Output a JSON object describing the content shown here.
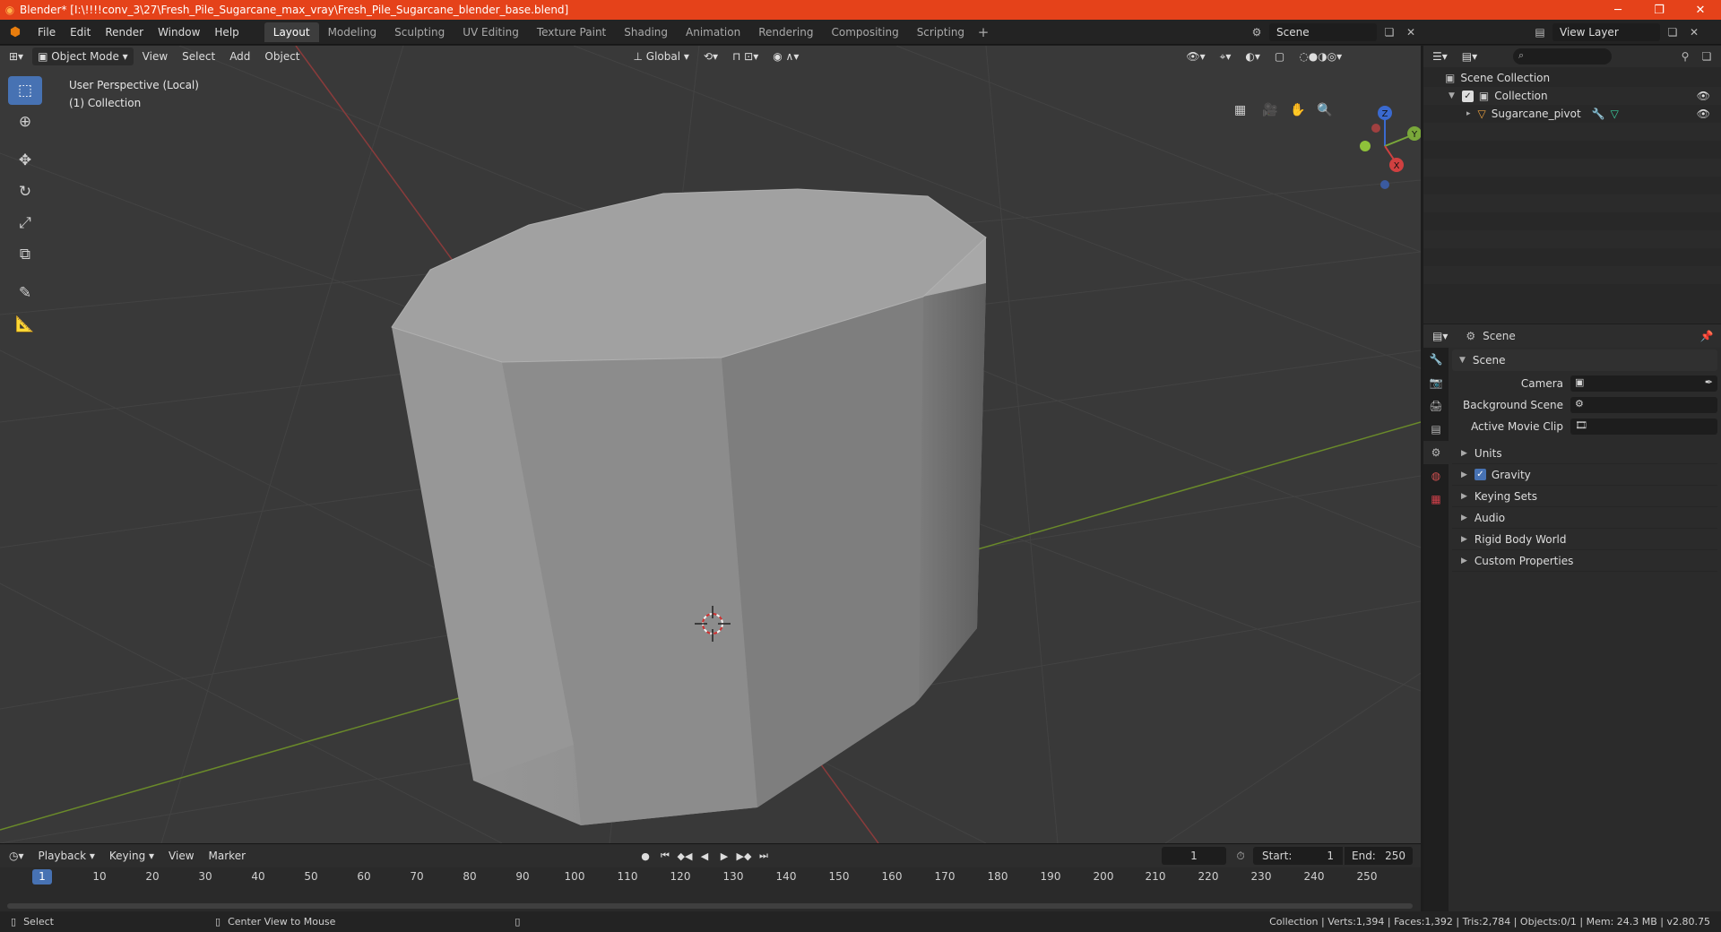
{
  "window": {
    "title": "Blender* [I:\\!!!!conv_3\\27\\Fresh_Pile_Sugarcane_max_vray\\Fresh_Pile_Sugarcane_blender_base.blend]"
  },
  "menu": {
    "file": "File",
    "edit": "Edit",
    "render": "Render",
    "window": "Window",
    "help": "Help"
  },
  "workspaces": [
    "Layout",
    "Modeling",
    "Sculpting",
    "UV Editing",
    "Texture Paint",
    "Shading",
    "Animation",
    "Rendering",
    "Compositing",
    "Scripting"
  ],
  "scene_selector": {
    "value": "Scene"
  },
  "view_layer_selector": {
    "value": "View Layer"
  },
  "viewport": {
    "mode": "Object Mode",
    "menus": {
      "view": "View",
      "select": "Select",
      "add": "Add",
      "object": "Object"
    },
    "transform_orientation": "Global",
    "info_line1": "User Perspective (Local)",
    "info_line2": "(1) Collection",
    "gizmo": {
      "z": "Z",
      "y": "Y",
      "x": "X"
    }
  },
  "outliner": {
    "root": "Scene Collection",
    "collection": "Collection",
    "object": "Sugarcane_pivot"
  },
  "properties": {
    "header_title": "Scene",
    "panel_title": "Scene",
    "camera_label": "Camera",
    "background_scene_label": "Background Scene",
    "active_movie_clip_label": "Active Movie Clip",
    "subpanels": {
      "units": "Units",
      "gravity": "Gravity",
      "keying_sets": "Keying Sets",
      "audio": "Audio",
      "rigid_body_world": "Rigid Body World",
      "custom_properties": "Custom Properties"
    }
  },
  "timeline": {
    "menus": {
      "playback": "Playback",
      "keying": "Keying",
      "view": "View",
      "marker": "Marker"
    },
    "current_frame": "1",
    "start_label": "Start:",
    "start_value": "1",
    "end_label": "End:",
    "end_value": "250",
    "ruler_current": "1",
    "ruler_ticks": [
      "10",
      "20",
      "30",
      "40",
      "50",
      "60",
      "70",
      "80",
      "90",
      "100",
      "110",
      "120",
      "130",
      "140",
      "150",
      "160",
      "170",
      "180",
      "190",
      "200",
      "210",
      "220",
      "230",
      "240",
      "250"
    ]
  },
  "statusbar": {
    "select": "Select",
    "center_view": "Center View to Mouse",
    "stats": "Collection | Verts:1,394 | Faces:1,392 | Tris:2,784 | Objects:0/1 | Mem: 24.3 MB | v2.80.75"
  },
  "colors": {
    "titlebar": "#e5421a",
    "accent": "#4772b3",
    "viewport_bg": "#393939"
  }
}
